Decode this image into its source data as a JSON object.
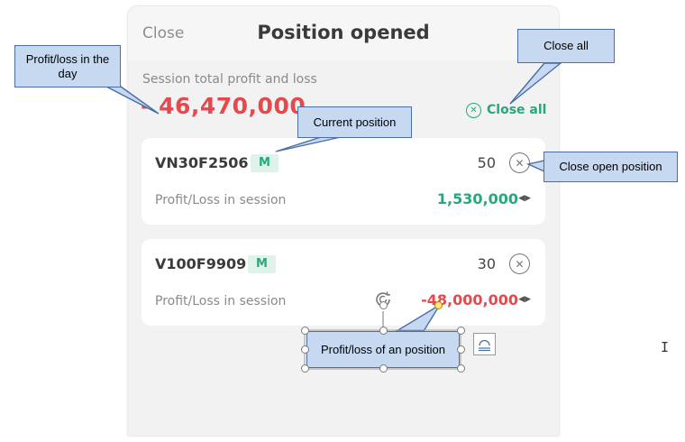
{
  "header": {
    "close_label": "Close",
    "title": "Position opened"
  },
  "session": {
    "label": "Session total profit and loss",
    "total": "- 46,470,000",
    "close_all_label": "Close all",
    "close_all_icon": "x-circle-icon"
  },
  "positions": [
    {
      "symbol": "VN30F2506",
      "badge": "M",
      "quantity": "50",
      "pl_label": "Profit/Loss in session",
      "pl_value": "1,530,000",
      "pl_color": "#23a97a"
    },
    {
      "symbol": "V100F9909",
      "badge": "M",
      "quantity": "30",
      "pl_label": "Profit/Loss in session",
      "pl_value": "-48,000,000",
      "pl_color": "#e5484d"
    }
  ],
  "callouts": {
    "profit_day": "Profit/loss in the day",
    "close_all": "Close all",
    "current_position": "Current position",
    "close_open_position": "Close open position",
    "position_pl": "Profit/loss of an position"
  },
  "colors": {
    "profit": "#23a97a",
    "loss": "#e5484d",
    "callout_fill": "#c6d9f0",
    "callout_border": "#4a6fa5"
  }
}
